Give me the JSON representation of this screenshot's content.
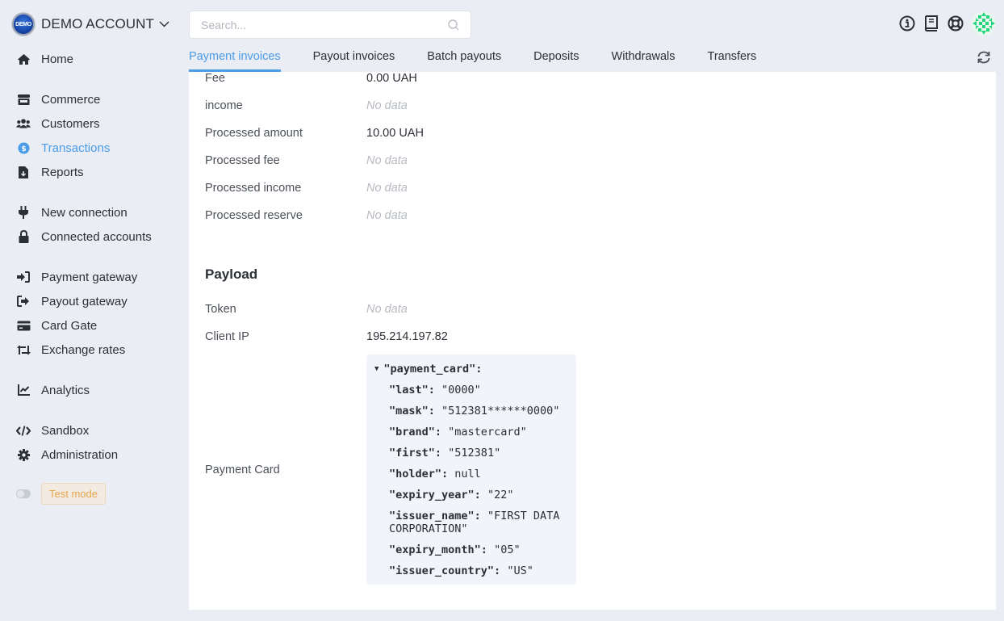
{
  "account": {
    "name": "DEMO ACCOUNT",
    "logo_text": "DEMO"
  },
  "sidebar": {
    "items": [
      {
        "label": "Home",
        "icon": "home-icon"
      },
      {
        "label": "Commerce",
        "icon": "store-icon"
      },
      {
        "label": "Customers",
        "icon": "users-icon"
      },
      {
        "label": "Transactions",
        "icon": "dollar-circle-icon",
        "active": true
      },
      {
        "label": "Reports",
        "icon": "file-download-icon"
      },
      {
        "label": "New connection",
        "icon": "plug-icon"
      },
      {
        "label": "Connected accounts",
        "icon": "lock-icon"
      },
      {
        "label": "Payment gateway",
        "icon": "sign-in-icon"
      },
      {
        "label": "Payout gateway",
        "icon": "sign-out-icon"
      },
      {
        "label": "Card Gate",
        "icon": "credit-card-icon"
      },
      {
        "label": "Exchange rates",
        "icon": "retweet-icon"
      },
      {
        "label": "Analytics",
        "icon": "chart-line-icon"
      },
      {
        "label": "Sandbox",
        "icon": "code-icon"
      },
      {
        "label": "Administration",
        "icon": "gear-icon"
      }
    ],
    "test_mode_label": "Test mode"
  },
  "header": {
    "search_placeholder": "Search...",
    "tabs": [
      {
        "label": "Payment invoices",
        "active": true
      },
      {
        "label": "Payout invoices"
      },
      {
        "label": "Batch payouts"
      },
      {
        "label": "Deposits"
      },
      {
        "label": "Withdrawals"
      },
      {
        "label": "Transfers"
      }
    ]
  },
  "details": {
    "rows": [
      {
        "label": "Fee",
        "value": "0.00 UAH"
      },
      {
        "label": "income",
        "value": "No data",
        "empty": true
      },
      {
        "label": "Processed amount",
        "value": "10.00 UAH"
      },
      {
        "label": "Processed fee",
        "value": "No data",
        "empty": true
      },
      {
        "label": "Processed income",
        "value": "No data",
        "empty": true
      },
      {
        "label": "Processed reserve",
        "value": "No data",
        "empty": true
      }
    ]
  },
  "payload": {
    "title": "Payload",
    "rows": [
      {
        "label": "Token",
        "value": "No data",
        "empty": true
      },
      {
        "label": "Client IP",
        "value": "195.214.197.82"
      }
    ],
    "card_label": "Payment Card",
    "card_root_key": "\"payment_card\":",
    "card_fields": [
      {
        "key": "\"last\":",
        "value": "\"0000\""
      },
      {
        "key": "\"mask\":",
        "value": "\"512381******0000\""
      },
      {
        "key": "\"brand\":",
        "value": "\"mastercard\""
      },
      {
        "key": "\"first\":",
        "value": "\"512381\""
      },
      {
        "key": "\"holder\":",
        "value": "null"
      },
      {
        "key": "\"expiry_year\":",
        "value": "\"22\""
      },
      {
        "key": "\"issuer_name\":",
        "value": "\"FIRST DATA CORPORATION\""
      },
      {
        "key": "\"expiry_month\":",
        "value": "\"05\""
      },
      {
        "key": "\"issuer_country\":",
        "value": "\"US\""
      }
    ]
  },
  "colors": {
    "accent": "#4a9be8",
    "test_mode": "#e5a44a",
    "empty_value": "#b6bac1"
  }
}
